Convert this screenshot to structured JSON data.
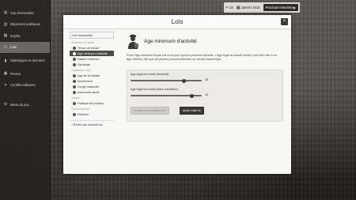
{
  "sidebar": {
    "items": [
      {
        "label": "Vue d'ensemble",
        "icon": "overview-icon"
      },
      {
        "label": "Dépenses publiques",
        "icon": "spending-icon"
      },
      {
        "label": "Impôts",
        "icon": "taxes-icon"
      },
      {
        "label": "Lois",
        "icon": "laws-icon",
        "active": true
      },
      {
        "label": "Statistiques et données",
        "icon": "stats-icon"
      },
      {
        "label": "Presse",
        "icon": "press-icon"
      },
      {
        "label": "Conflits militaires",
        "icon": "military-icon"
      }
    ],
    "menu_label": "Menu du jeu..."
  },
  "topbar": {
    "count": "20",
    "date": "Janvier 2018",
    "next_button": "Prochain trimestre"
  },
  "modal": {
    "title": "Lois",
    "close": "×",
    "nav": {
      "overview": "Vue d'ensemble",
      "groups": [
        {
          "label": "Relations au travail",
          "items": [
            "Temps de travail",
            "Age minimum d'activité",
            "Salaire minimum",
            "Syndicats"
          ],
          "selected": 1
        },
        {
          "label": "Législation civile",
          "items": [
            "Age de la retraite",
            "Avortement",
            "Congé maternité",
            "Assurance santé"
          ]
        },
        {
          "label": "Justice",
          "items": [
            "Politique de punition"
          ]
        },
        {
          "label": "Environnement",
          "items": [
            "Pollution"
          ]
        }
      ],
      "add_law": "+ Écrire une nouvelle loi"
    },
    "content": {
      "title": "Age minimum d'activité",
      "description": "Pose l'âge minimum requis par la loi pour qu'une personne travaille. L'âge légal de travail «limité» peut être fixé à un âge inférieur afin que les jeunes puissent effectuer un certain travail léger.",
      "slider1": {
        "label": "Age légal de travail (restreint):",
        "value": 18,
        "min": 0,
        "max": 18,
        "fraction": 0.75,
        "value_text": "18"
      },
      "slider2": {
        "label": "Age légal de travail (sans restriction):",
        "value": 18,
        "min": 0,
        "max": 18,
        "fraction": 0.86,
        "value_text": "18"
      },
      "undo_button": "Annuler les changements",
      "abolish_button": "Abolir cette loi"
    }
  }
}
